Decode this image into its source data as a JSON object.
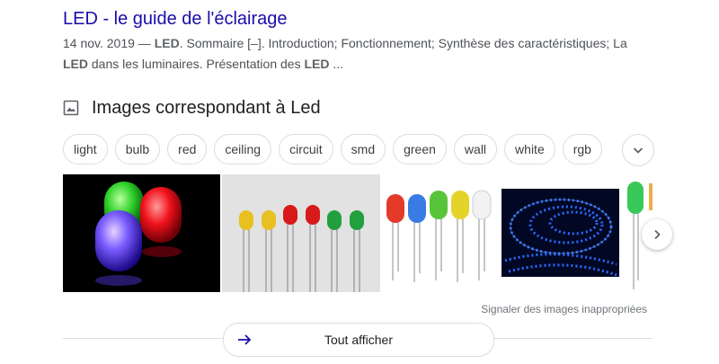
{
  "result": {
    "title": "LED - le guide de l'éclairage",
    "date": "14 nov. 2019",
    "snippet_parts": [
      "LED",
      ". Sommaire [–]. Introduction; Fonctionnement; Synthèse des caractéristiques; La ",
      "LED",
      " dans les luminaires. Présentation des ",
      "LED",
      " ..."
    ],
    "date_sep": " — "
  },
  "images_section": {
    "heading": "Images correspondant à Led",
    "chips": [
      "light",
      "bulb",
      "red",
      "ceiling",
      "circuit",
      "smd",
      "green",
      "wall",
      "white",
      "rgb"
    ],
    "report_link": "Signaler des images inappropriées",
    "show_all": "Tout afficher"
  },
  "colors": {
    "link": "#1a0dab",
    "accent": "#1a73e8"
  }
}
